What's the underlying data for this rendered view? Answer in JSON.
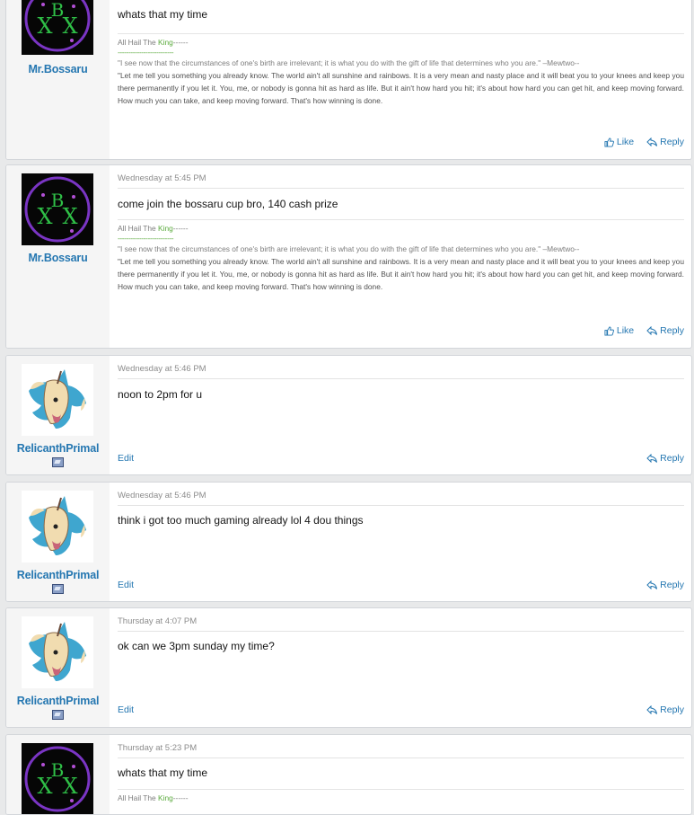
{
  "colors": {
    "page_bg": "#e8e9ea",
    "link_blue": "#2577b1",
    "king_green": "#5aaa3c"
  },
  "signature": {
    "hail_prefix": "All Hail The ",
    "king": "King",
    "hail_suffix": "------",
    "dashes": "--------------------------",
    "quote1": "\"I see now that the circumstances of one's birth are irrelevant; it is what you do with the gift of life that determines who you are.\" –Mewtwo--",
    "quote2": "\"Let me tell you something you already know. The world ain't all sunshine and rainbows. It is a very mean and nasty place and it will beat you to your knees and keep you there permanently if you let it. You, me, or nobody is gonna hit as hard as life. But it ain't how hard you hit; it's about how hard you can get hit, and keep moving forward. How much you can take, and keep moving forward. That's how winning is done."
  },
  "actions": {
    "like": "Like",
    "reply": "Reply",
    "edit": "Edit"
  },
  "posts": [
    {
      "user": "Mr.Bossaru",
      "avatar_icon": "xbx-purple-circle-avatar",
      "date": "",
      "message": "whats that my time"
    },
    {
      "user": "Mr.Bossaru",
      "avatar_icon": "xbx-purple-circle-avatar",
      "date": "Wednesday at 5:45 PM",
      "message": "come join the bossaru cup bro, 140 cash prize"
    },
    {
      "user": "RelicanthPrimal",
      "avatar_icon": "relicanth-avatar",
      "date": "Wednesday at 5:46 PM",
      "message": "noon to 2pm for u"
    },
    {
      "user": "RelicanthPrimal",
      "avatar_icon": "relicanth-avatar",
      "date": "Wednesday at 5:46 PM",
      "message": "think i got too much gaming already lol 4 dou things"
    },
    {
      "user": "RelicanthPrimal",
      "avatar_icon": "relicanth-avatar",
      "date": "Thursday at 4:07 PM",
      "message": "ok can we 3pm sunday my time?"
    },
    {
      "user": "Mr.Bossaru",
      "avatar_icon": "xbx-purple-circle-avatar",
      "date": "Thursday at 5:23 PM",
      "message": "whats that my time"
    }
  ]
}
